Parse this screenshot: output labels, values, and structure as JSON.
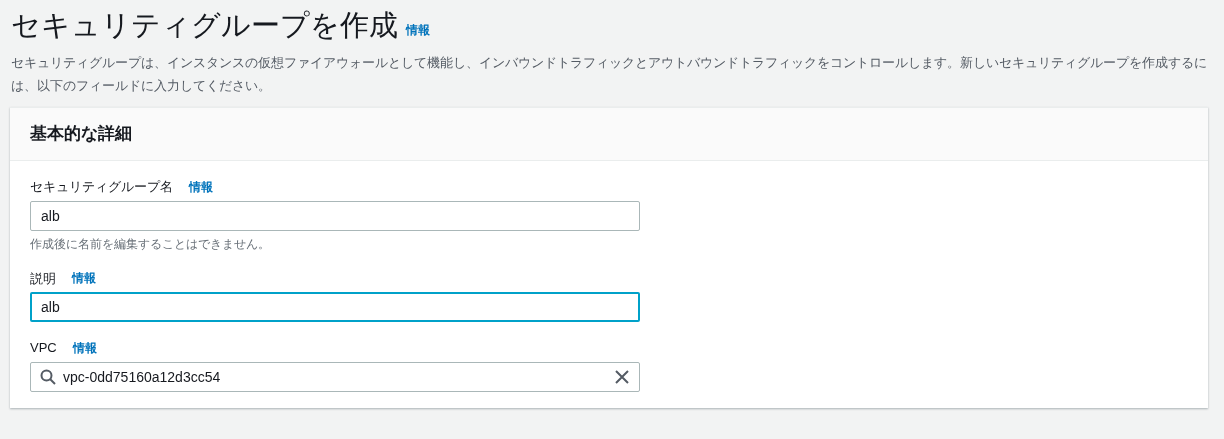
{
  "header": {
    "title": "セキュリティグループを作成",
    "info": "情報",
    "description": "セキュリティグループは、インスタンスの仮想ファイアウォールとして機能し、インバウンドトラフィックとアウトバウンドトラフィックをコントロールします。新しいセキュリティグループを作成するには、以下のフィールドに入力してください。"
  },
  "panel": {
    "title": "基本的な詳細",
    "fields": [
      {
        "kind": "text",
        "label": "セキュリティグループ名",
        "info": "情報",
        "value": "alb",
        "hint": "作成後に名前を編集することはできません。",
        "focused": false
      },
      {
        "kind": "text",
        "label": "説明",
        "info": "情報",
        "value": "alb",
        "focused": true
      },
      {
        "kind": "search",
        "label": "VPC",
        "info": "情報",
        "value": "vpc-0dd75160a12d3cc54",
        "focused": false
      }
    ]
  }
}
